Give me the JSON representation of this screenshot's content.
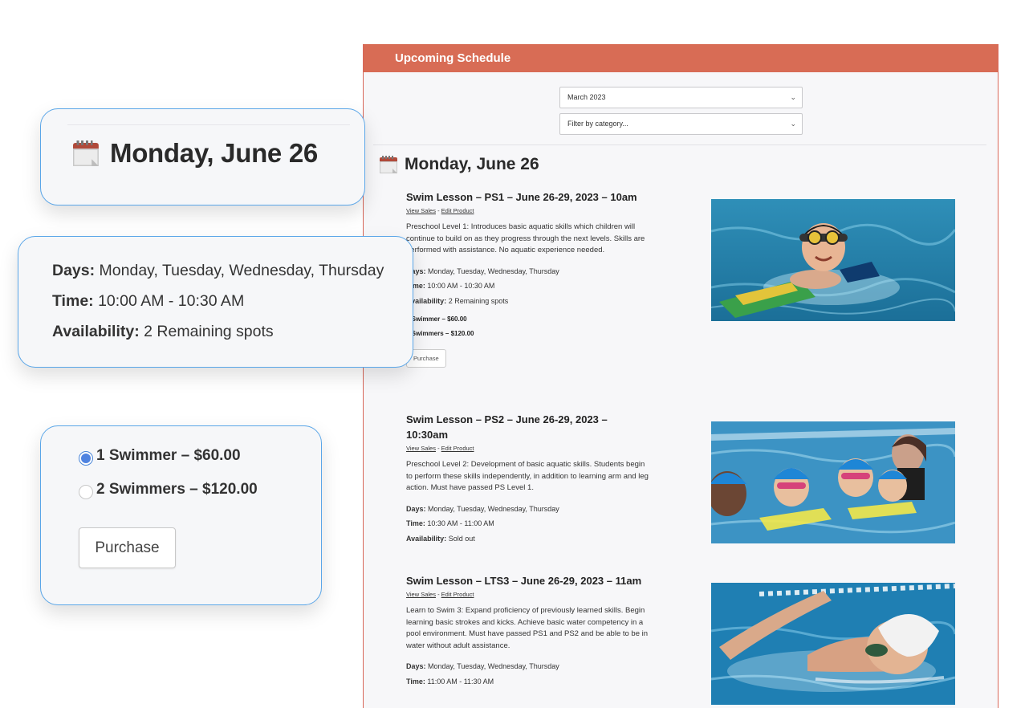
{
  "panel": {
    "header": "Upcoming Schedule",
    "month_select": "March 2023",
    "category_select": "Filter by category...",
    "day_title": "Monday, June 26"
  },
  "lessons": [
    {
      "title": "Swim Lesson – PS1 – June 26-29, 2023 – 10am",
      "view_sales": "View Sales",
      "sep": "-",
      "edit_product": "Edit Product",
      "description": "Preschool Level 1: Introduces basic aquatic skills which children will continue to build on as they progress through the next levels.  Skills are performed with assistance.   No aquatic experience needed.",
      "days_label": "Days:",
      "days": "Monday, Tuesday, Wednesday, Thursday",
      "time_label": "Time:",
      "time": "10:00 AM - 10:30 AM",
      "availability_label": "Availability:",
      "availability": "2 Remaining spots",
      "option_1": "1 Swimmer – $60.00",
      "option_2": "2 Swimmers – $120.00",
      "purchase": "Purchase"
    },
    {
      "title": "Swim Lesson – PS2 – June 26-29, 2023 – 10:30am",
      "view_sales": "View Sales",
      "sep": "-",
      "edit_product": "Edit Product",
      "description": "Preschool Level 2: Development of basic aquatic skills.  Students begin to perform these skills independently, in addition to learning arm and leg action.   Must have passed PS Level 1.",
      "days_label": "Days:",
      "days": "Monday, Tuesday, Wednesday, Thursday",
      "time_label": "Time:",
      "time": "10:30 AM - 11:00 AM",
      "availability_label": "Availability:",
      "availability": "Sold out"
    },
    {
      "title": "Swim Lesson – LTS3 – June 26-29, 2023 – 11am",
      "view_sales": "View Sales",
      "sep": "-",
      "edit_product": "Edit Product",
      "description": "Learn to Swim 3: Expand proficiency of previously learned skills. Begin learning basic strokes and kicks. Achieve basic water competency in a pool environment. Must have passed PS1 and PS2 and be able to be in water without adult assistance.",
      "days_label": "Days:",
      "days": "Monday, Tuesday, Wednesday, Thursday",
      "time_label": "Time:",
      "time": "11:00 AM - 11:30 AM"
    }
  ],
  "callouts": {
    "date_card": {
      "title": "Monday, June 26"
    },
    "info_card": {
      "days_label": "Days:",
      "days": "Monday, Tuesday, Wednesday, Thursday",
      "time_label": "Time:",
      "time": "10:00 AM - 10:30 AM",
      "availability_label": "Availability:",
      "availability": "2 Remaining spots"
    },
    "purchase_card": {
      "option_1": "1 Swimmer – $60.00",
      "option_2": "2 Swimmers – $120.00",
      "purchase": "Purchase"
    }
  },
  "colors": {
    "header_bg": "#d86c55",
    "card_border": "#5aa6e8",
    "radio_checked": "#4f83e0"
  },
  "icons": [
    "calendar-icon",
    "chevron-down-icon",
    "radio-checked",
    "radio-unchecked"
  ]
}
